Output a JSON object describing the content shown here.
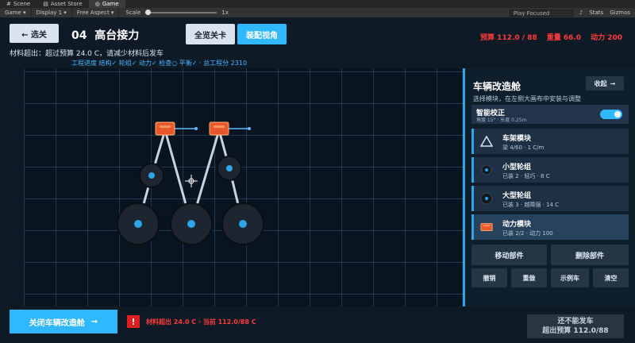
{
  "editor": {
    "tabs": [
      {
        "label": "Scene",
        "icon": "scene-icon"
      },
      {
        "label": "Asset Store",
        "icon": "store-icon"
      },
      {
        "label": "Game",
        "icon": "game-icon"
      }
    ],
    "game_select": "Game",
    "display_select": "Display 1",
    "aspect_select": "Free Aspect",
    "scale_label": "Scale",
    "scale_value": "1x",
    "play_mode": "Play Focused",
    "stats_label": "Stats",
    "gizmos_label": "Gizmos"
  },
  "header": {
    "back_label": "← 选关",
    "level_number": "04",
    "level_name": "高台接力",
    "overview_label": "全览关卡",
    "assembly_label": "装配视角",
    "budget": "预算  112.0 / 88",
    "weight": "重量  66.0",
    "power": "动力  200",
    "warning": "材料超出：超过预算 24.0 C，请减少材料后发车",
    "progress": "工程进度  结构✓ 轮组✓ 动力✓ 检查○ 平衡✓  ·  总工程分 2310"
  },
  "panel": {
    "title": "车辆改造舱",
    "collapse_label": "收起",
    "hint": "选择模块，在左侧大画布中安装与调整",
    "calibration": {
      "title": "智能校正",
      "detail": "角度 15°  ·  长度 0.25m",
      "enabled": true
    },
    "modules": [
      {
        "name": "车架模块",
        "detail": "梁 4/60  ·  1 C/m",
        "icon": "frame-triangle-icon"
      },
      {
        "name": "小型轮组",
        "detail": "已装 2  ·  轻巧  ·  8 C",
        "icon": "small-wheel-icon"
      },
      {
        "name": "大型轮组",
        "detail": "已装 3  ·  越障强  ·  14 C",
        "icon": "large-wheel-icon"
      },
      {
        "name": "动力模块",
        "detail": "已装 2/2  ·  动力 100",
        "icon": "engine-icon"
      }
    ],
    "move_label": "移动部件",
    "delete_label": "删除部件",
    "undo_label": "撤销",
    "redo_label": "重做",
    "example_label": "示例车",
    "clear_label": "清空"
  },
  "footer": {
    "close_label": "关闭车辆改造舱",
    "close_arrow": "→",
    "alert_icon": "!",
    "alert_text": "材料超出  24.0 C  ·  当前 112.0/88 C",
    "launch_title": "还不能发车",
    "launch_detail": "超出预算 112.0/88"
  },
  "colors": {
    "accent": "#2fb7ff",
    "danger": "#ff3b3b",
    "engine": "#e8582a",
    "grid": "#1f3a52",
    "panel_bg": "#0f1e2b"
  }
}
